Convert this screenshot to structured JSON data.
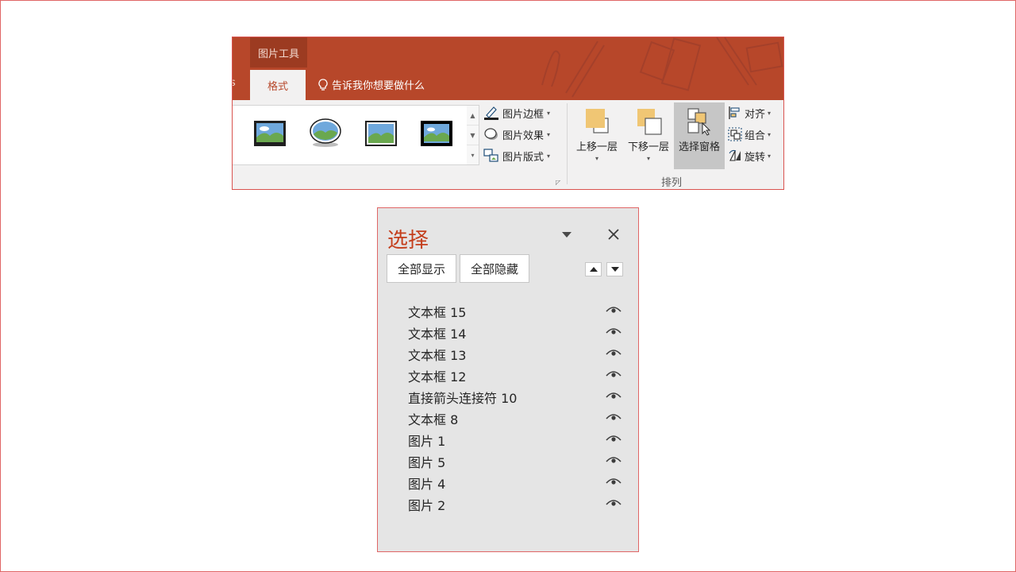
{
  "ribbon": {
    "context_tab": "图片工具",
    "cut_tab": "s",
    "active_tab": "格式",
    "tell_me": "告诉我你想要做什么",
    "picture_border": "图片边框",
    "picture_effects": "图片效果",
    "picture_layout": "图片版式",
    "bring_forward": "上移一层",
    "send_backward": "下移一层",
    "selection_pane": "选择窗格",
    "align": "对齐",
    "group": "组合",
    "rotate": "旋转",
    "arrange_label": "排列",
    "colors": {
      "accent": "#b7472a",
      "accent_dark": "#9c3b21",
      "shape_fill": "#f0c674"
    }
  },
  "pane": {
    "title": "选择",
    "show_all": "全部显示",
    "hide_all": "全部隐藏",
    "items": [
      {
        "label": "文本框 15"
      },
      {
        "label": "文本框 14"
      },
      {
        "label": "文本框 13"
      },
      {
        "label": "文本框 12"
      },
      {
        "label": "直接箭头连接符 10"
      },
      {
        "label": "文本框 8"
      },
      {
        "label": "图片 1"
      },
      {
        "label": "图片 5"
      },
      {
        "label": "图片 4"
      },
      {
        "label": "图片 2"
      }
    ],
    "icons": {
      "dropdown": "triangle-down-icon",
      "close": "close-icon",
      "visibility": "eye-icon"
    }
  }
}
